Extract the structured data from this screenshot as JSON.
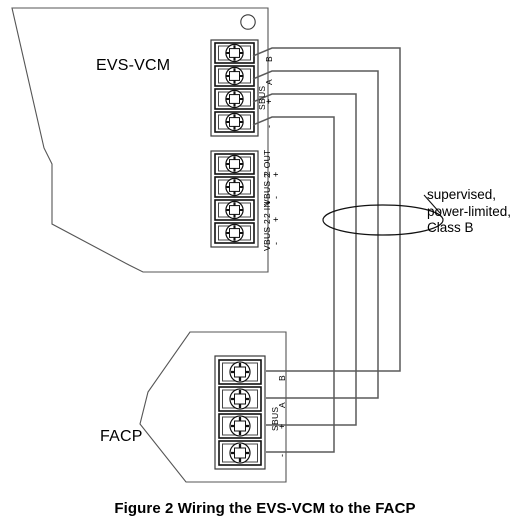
{
  "figure": {
    "caption": "Figure 2  Wiring the EVS-VCM to the FACP"
  },
  "devices": {
    "top": {
      "name": "EVS-VCM"
    },
    "bottom": {
      "name": "FACP"
    }
  },
  "annotation": {
    "line1": "supervised,",
    "line2": "power-limited,",
    "line3": "Class B"
  },
  "terminal_blocks": {
    "evs_sbus": {
      "group_label": "SBUS",
      "terminals": [
        {
          "label": "B"
        },
        {
          "label": "A"
        },
        {
          "label": "+"
        },
        {
          "label": "-"
        }
      ]
    },
    "evs_vbus": {
      "terminals": [
        {
          "label": "2 OUT",
          "sign": "+"
        },
        {
          "label": "VBUS 2",
          "sign": "-"
        },
        {
          "label": "2 IN",
          "sign": "+"
        },
        {
          "label": "VBUS 2",
          "sign": "-"
        }
      ]
    },
    "facp_sbus": {
      "group_label": "SBUS",
      "terminals": [
        {
          "label": "B"
        },
        {
          "label": "A"
        },
        {
          "label": "+"
        },
        {
          "label": "-"
        }
      ]
    }
  },
  "colors": {
    "line": "#000000",
    "wire": "#5a5a5a",
    "enclosure": "#555555",
    "text": "#000000"
  }
}
